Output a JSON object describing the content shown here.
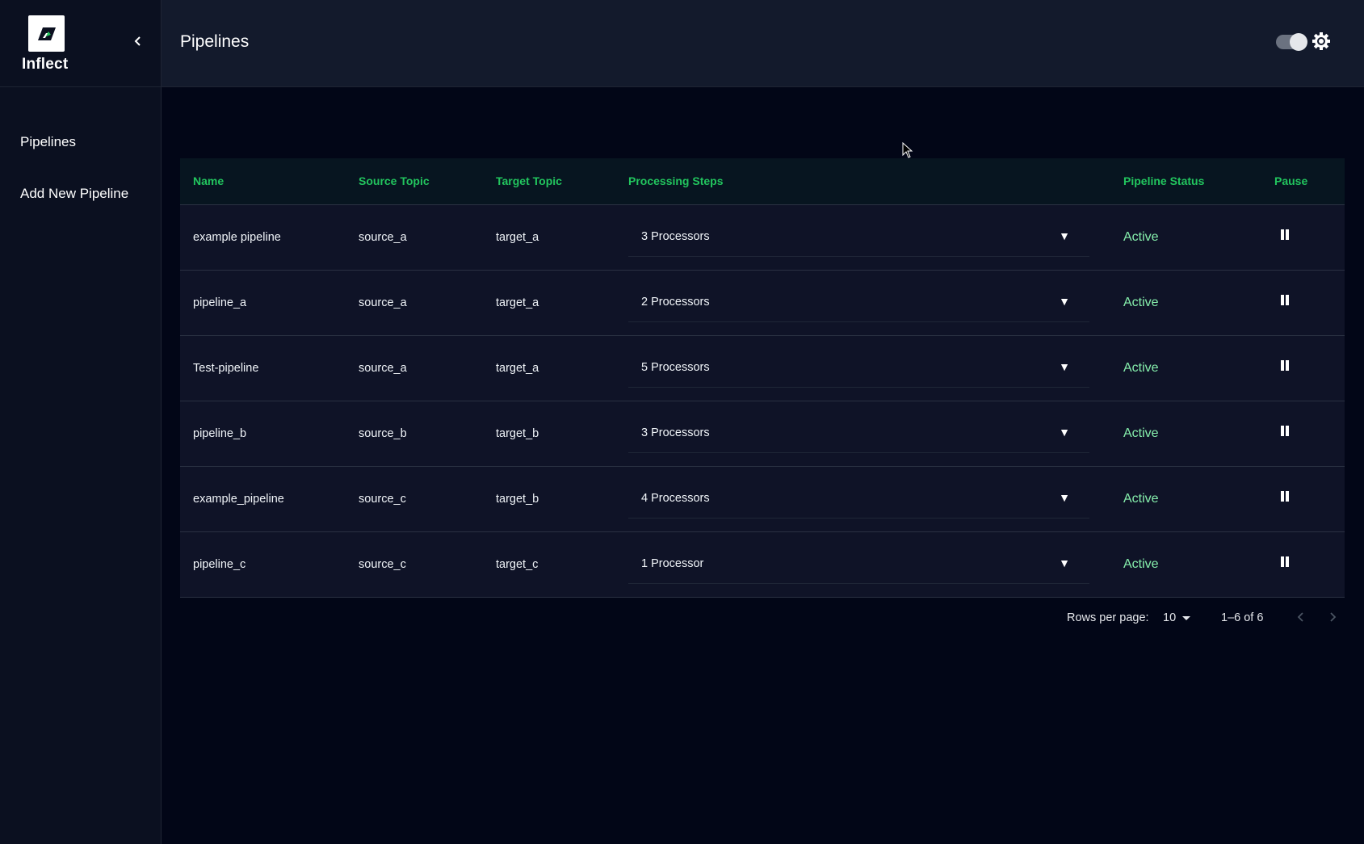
{
  "app": {
    "brand_name": "Inflect"
  },
  "sidebar": {
    "items": [
      {
        "label": "Pipelines"
      },
      {
        "label": "Add New Pipeline"
      }
    ]
  },
  "header": {
    "title": "Pipelines"
  },
  "table": {
    "columns": [
      "Name",
      "Source Topic",
      "Target Topic",
      "Processing Steps",
      "Pipeline Status",
      "Pause"
    ],
    "rows": [
      {
        "name": "example pipeline",
        "source": "source_a",
        "target": "target_a",
        "steps": "3 Processors",
        "status": "Active"
      },
      {
        "name": "pipeline_a",
        "source": "source_a",
        "target": "target_a",
        "steps": "2 Processors",
        "status": "Active"
      },
      {
        "name": "Test-pipeline",
        "source": "source_a",
        "target": "target_a",
        "steps": "5 Processors",
        "status": "Active"
      },
      {
        "name": "pipeline_b",
        "source": "source_b",
        "target": "target_b",
        "steps": "3 Processors",
        "status": "Active"
      },
      {
        "name": "example_pipeline",
        "source": "source_c",
        "target": "target_b",
        "steps": "4 Processors",
        "status": "Active"
      },
      {
        "name": "pipeline_c",
        "source": "source_c",
        "target": "target_c",
        "steps": "1 Processor",
        "status": "Active"
      }
    ]
  },
  "pagination": {
    "rows_per_page_label": "Rows per page:",
    "rows_per_page": "10",
    "range": "1–6 of 6"
  },
  "colors": {
    "accent": "#22c55e",
    "status_active": "#86efac",
    "background": "#020617",
    "sidebar": "#0b1020",
    "topbar": "#131a2c"
  },
  "icons": [
    "inflect-logo",
    "chevron-left-icon",
    "theme-toggle",
    "gear-icon",
    "dropdown-arrow-icon",
    "pause-icon",
    "chevron-right-icon"
  ]
}
